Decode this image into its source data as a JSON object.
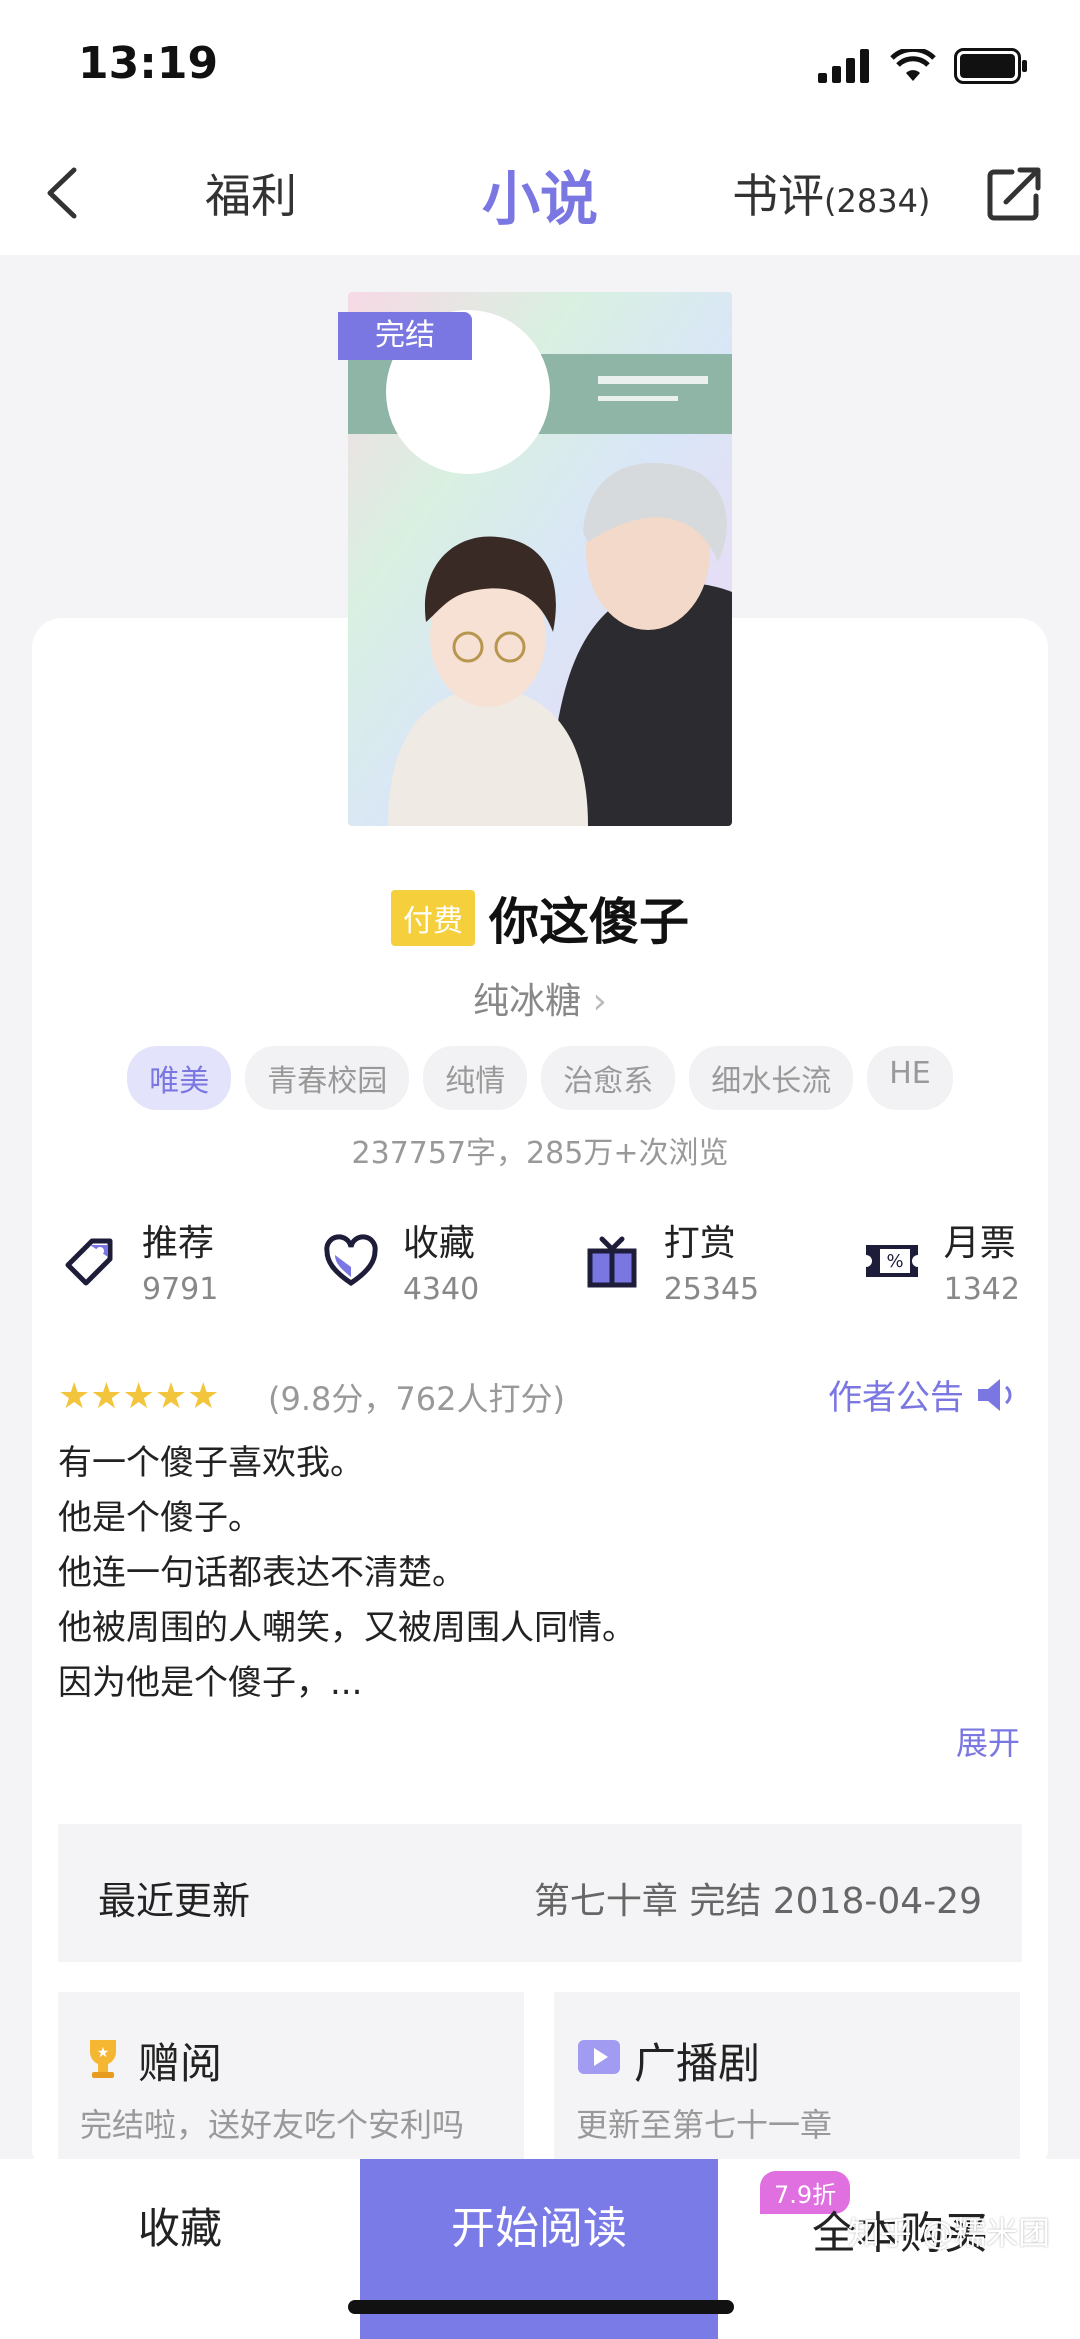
{
  "status": {
    "time": "13:19"
  },
  "nav": {
    "tabs": [
      {
        "label": "福利"
      },
      {
        "label": "小说"
      },
      {
        "label": "书评",
        "count": "(2834)"
      }
    ]
  },
  "book": {
    "status_badge": "完结",
    "paid_badge": "付费",
    "title": "你这傻子",
    "author": "纯冰糖",
    "tags": [
      "唯美",
      "青春校园",
      "纯情",
      "治愈系",
      "细水长流",
      "HE"
    ],
    "stats": "237757字，285万+次浏览"
  },
  "actions": [
    {
      "label": "推荐",
      "count": "9791",
      "icon": "tag-icon"
    },
    {
      "label": "收藏",
      "count": "4340",
      "icon": "heart-icon"
    },
    {
      "label": "打赏",
      "count": "25345",
      "icon": "gift-icon"
    },
    {
      "label": "月票",
      "count": "1342",
      "icon": "ticket-icon"
    }
  ],
  "rating": {
    "stars": "★★★★★",
    "text": "(9.8分，762人打分)",
    "notice": "作者公告"
  },
  "description": {
    "lines": [
      "有一个傻子喜欢我。",
      "他是个傻子。",
      "他连一句话都表达不清楚。",
      "他被周围的人嘲笑，又被周围人同情。",
      "因为他是个傻子，..."
    ],
    "expand": "展开"
  },
  "latest": {
    "label": "最近更新",
    "value": "第七十章 完结 2018-04-29"
  },
  "features": [
    {
      "title": "赠阅",
      "subtitle": "完结啦，送好友吃个安利吗"
    },
    {
      "title": "广播剧",
      "subtitle": "更新至第七十一章"
    }
  ],
  "bottom": {
    "favorite": "收藏",
    "read": "开始阅读",
    "buy": "全本购买",
    "discount": "7.9折"
  },
  "watermark": "知乎 @糯米团",
  "colors": {
    "accent": "#7b77e2",
    "paid": "#f5cf3c",
    "discount": "#e06fe0"
  }
}
